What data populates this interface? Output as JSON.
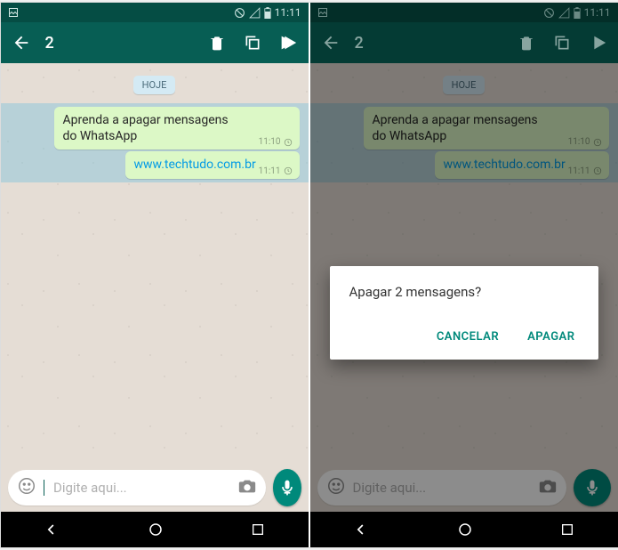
{
  "status": {
    "time": "11:11"
  },
  "selection": {
    "count": "2"
  },
  "chat": {
    "date_label": "HOJE",
    "messages": [
      {
        "text": "Aprenda a apagar mensagens do WhatsApp",
        "time": "11:10"
      },
      {
        "text": "www.techtudo.com.br",
        "time": "11:11",
        "is_link": true
      }
    ]
  },
  "input": {
    "placeholder": "Digite aqui..."
  },
  "dialog": {
    "title": "Apagar 2 mensagens?",
    "cancel": "CANCELAR",
    "confirm": "APAGAR"
  }
}
